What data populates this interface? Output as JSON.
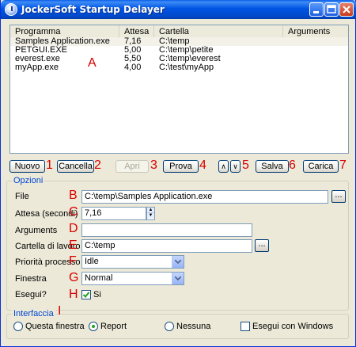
{
  "window": {
    "title": "JockerSoft Startup Delayer"
  },
  "list": {
    "columns": [
      "Programma",
      "Attesa",
      "Cartella",
      "Arguments"
    ],
    "rows": [
      {
        "programma": "Samples Application.exe",
        "attesa": "7,16",
        "cartella": "C:\\temp"
      },
      {
        "programma": "PETGUI.EXE",
        "attesa": "5,00",
        "cartella": "C:\\temp\\petite"
      },
      {
        "programma": "everest.exe",
        "attesa": "5,50",
        "cartella": "C:\\temp\\everest"
      },
      {
        "programma": "myApp.exe",
        "attesa": "4,00",
        "cartella": "C:\\test\\myApp"
      }
    ],
    "annotation": "A"
  },
  "buttons": {
    "nuovo": "Nuovo",
    "nuovo_num": "1",
    "cancella": "Cancella",
    "cancella_num": "2",
    "apri": "Apri",
    "apri_num": "3",
    "prova": "Prova",
    "prova_num": "4",
    "up": "∧",
    "down": "∨",
    "move_num": "5",
    "salva": "Salva",
    "salva_num": "6",
    "carica": "Carica",
    "carica_num": "7"
  },
  "options": {
    "title": "Opzioni",
    "file_label": "File",
    "file_value": "C:\\temp\\Samples Application.exe",
    "file_letter": "B",
    "attesa_label": "Attesa (secondi)",
    "attesa_value": "7,16",
    "attesa_letter": "C",
    "arguments_label": "Arguments",
    "arguments_value": "",
    "arguments_letter": "D",
    "cartella_label": "Cartella di lavoro",
    "cartella_value": "C:\\temp",
    "cartella_letter": "E",
    "priorita_label": "Priorità processo",
    "priorita_value": "Idle",
    "priorita_letter": "F",
    "finestra_label": "Finestra",
    "finestra_value": "Normal",
    "finestra_letter": "G",
    "esegui_label": "Esegui?",
    "esegui_value": "Si",
    "esegui_checked": true,
    "esegui_letter": "H",
    "browse_label": "..."
  },
  "interface": {
    "title": "Interfaccia",
    "letter": "I",
    "radio_questa": "Questa finestra",
    "radio_report": "Report",
    "radio_nessuna": "Nessuna",
    "selected": "Report",
    "check_windows": "Esegui con Windows",
    "check_windows_checked": false
  }
}
